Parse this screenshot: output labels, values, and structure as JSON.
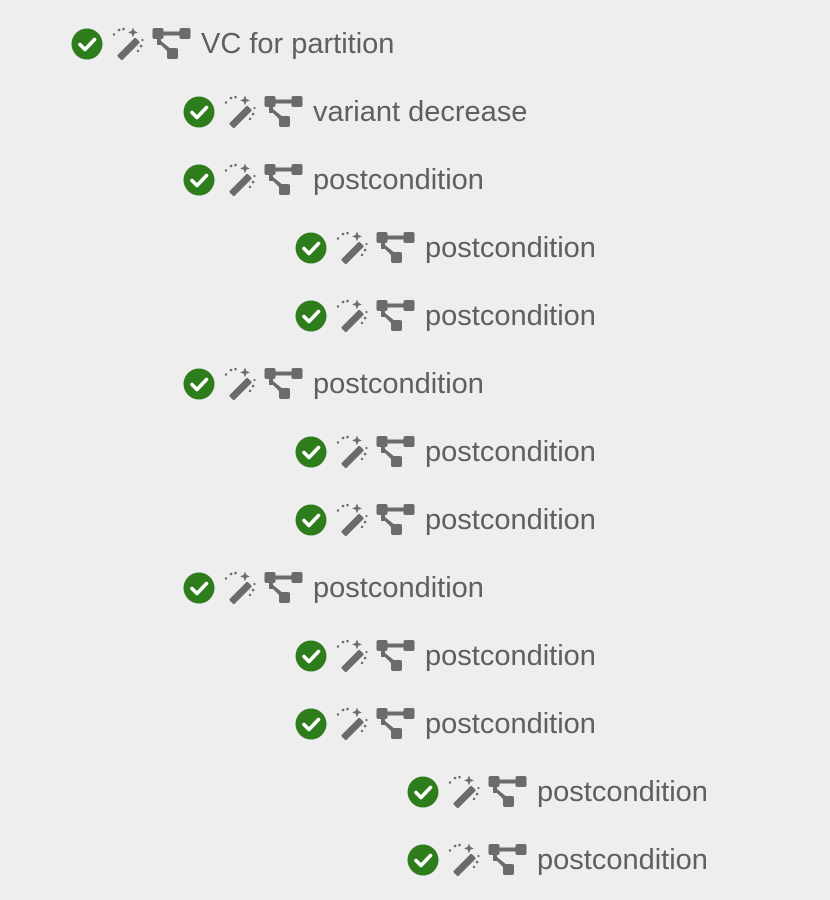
{
  "colors": {
    "background": "#eeeeee",
    "check": "#2e7d1c",
    "icon": "#6b6b6b",
    "text": "#5f5f5f"
  },
  "icons": {
    "status": "check-circle-icon",
    "action": "magic-wand-icon",
    "view": "tree-diagram-icon"
  },
  "tree": [
    {
      "label": "VC for partition",
      "depth": 0,
      "status": "valid"
    },
    {
      "label": "variant decrease",
      "depth": 1,
      "status": "valid"
    },
    {
      "label": "postcondition",
      "depth": 1,
      "status": "valid"
    },
    {
      "label": "postcondition",
      "depth": 2,
      "status": "valid"
    },
    {
      "label": "postcondition",
      "depth": 2,
      "status": "valid"
    },
    {
      "label": "postcondition",
      "depth": 1,
      "status": "valid"
    },
    {
      "label": "postcondition",
      "depth": 2,
      "status": "valid"
    },
    {
      "label": "postcondition",
      "depth": 2,
      "status": "valid"
    },
    {
      "label": "postcondition",
      "depth": 1,
      "status": "valid"
    },
    {
      "label": "postcondition",
      "depth": 2,
      "status": "valid"
    },
    {
      "label": "postcondition",
      "depth": 2,
      "status": "valid"
    },
    {
      "label": "postcondition",
      "depth": 3,
      "status": "valid"
    },
    {
      "label": "postcondition",
      "depth": 3,
      "status": "valid"
    }
  ]
}
